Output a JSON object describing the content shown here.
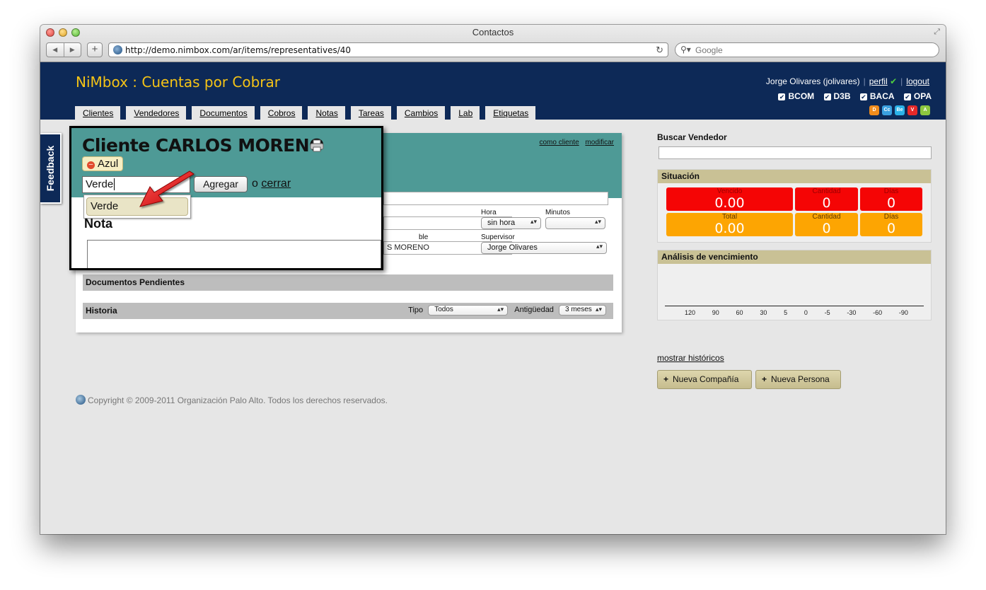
{
  "browser": {
    "title": "Contactos",
    "url": "http://demo.nimbox.com/ar/items/representatives/40",
    "search_placeholder": "Google"
  },
  "header": {
    "brand": "NiMbox : Cuentas por Cobrar",
    "user": "Jorge Olivares (jolivares)",
    "perfil": "perfil",
    "logout": "logout",
    "companies": [
      "BCOM",
      "D3B",
      "BACA",
      "OPA"
    ],
    "app_icons": [
      {
        "letter": "D",
        "color": "#f08c1c"
      },
      {
        "letter": "Cc",
        "color": "#3aa0e0"
      },
      {
        "letter": "Be",
        "color": "#2bb2e8"
      },
      {
        "letter": "V",
        "color": "#e52929"
      },
      {
        "letter": "A",
        "color": "#8cc63f"
      }
    ]
  },
  "tabs": [
    "Clientes",
    "Vendedores",
    "Documentos",
    "Cobros",
    "Notas",
    "Tareas",
    "Cambios",
    "Lab",
    "Etiquetas"
  ],
  "feedback": "Feedback",
  "card": {
    "link_cliente": "como cliente",
    "link_modificar": "modificar",
    "hora_label": "Hora",
    "hora_value": "sin hora",
    "minutos_label": "Minutos",
    "minutos_value": "",
    "responsable_label": "ble",
    "responsable_value": "S MORENO",
    "supervisor_label": "Supervisor",
    "supervisor_value": "Jorge Olivares",
    "docs_pendientes": "Documentos Pendientes",
    "historia": "Historia",
    "tipo_label": "Tipo",
    "tipo_value": "Todos",
    "antiguedad_label": "Antigüedad",
    "antiguedad_value": "3 meses"
  },
  "popup": {
    "title": "Cliente CARLOS MORENO",
    "tag": "Azul",
    "tag_input": "Verde",
    "add_button": "Agregar",
    "or": "o",
    "close_link": "cerrar",
    "suggestion": "Verde",
    "nota": "Nota"
  },
  "right": {
    "buscar_label": "Buscar Vendedor",
    "situacion": "Situación",
    "vencido_label": "Vencido",
    "vencido_value": "0.00",
    "cantidad_label": "Cantidad",
    "cantidad1_value": "0",
    "dias_label": "Días",
    "dias1_value": "0",
    "total_label": "Total",
    "total_value": "0.00",
    "cantidad2_value": "0",
    "dias2_value": "0",
    "analisis": "Análisis de vencimiento",
    "ticks": [
      "120",
      "90",
      "60",
      "30",
      "5",
      "0",
      "-5",
      "-30",
      "-60",
      "-90"
    ],
    "historicos": "mostrar históricos",
    "nueva_compania": "Nueva Compañía",
    "nueva_persona": "Nueva Persona"
  },
  "copyright": "Copyright © 2009-2011 Organización Palo Alto. Todos los derechos reservados."
}
